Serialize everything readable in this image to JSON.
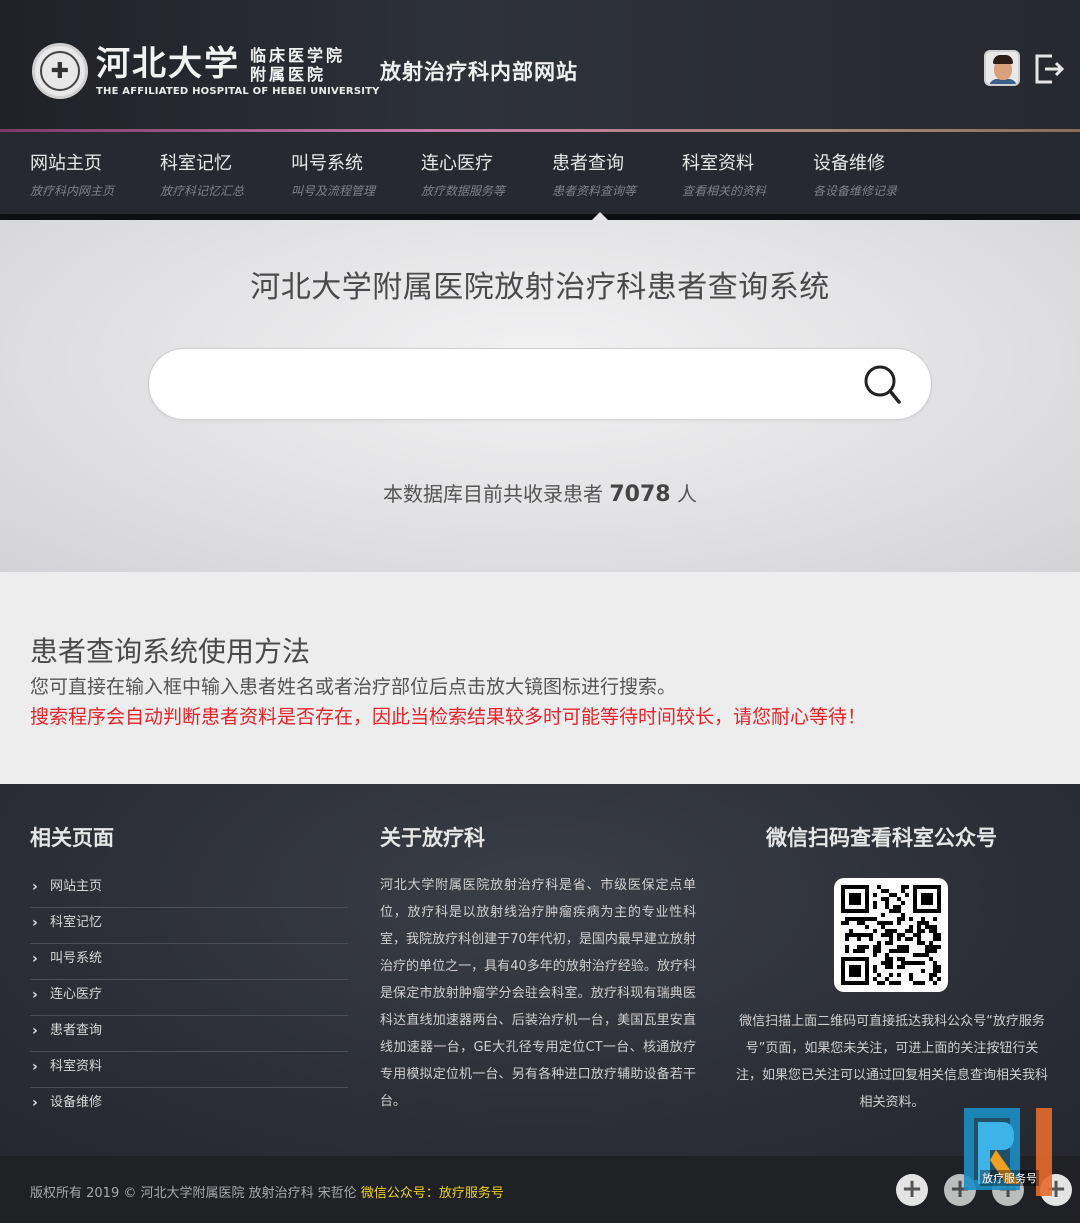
{
  "header": {
    "logo_big": "河北大学",
    "logo_small_1": "临床医学院",
    "logo_small_2": "附属医院",
    "logo_en": "THE AFFILIATED HOSPITAL OF HEBEI UNIVERSITY",
    "site_title": "放射治疗科内部网站"
  },
  "nav": {
    "items": [
      {
        "label": "网站主页",
        "sub": "放疗科内网主页"
      },
      {
        "label": "科室记忆",
        "sub": "放疗科记忆汇总"
      },
      {
        "label": "叫号系统",
        "sub": "叫号及流程管理"
      },
      {
        "label": "连心医疗",
        "sub": "放疗数据服务等"
      },
      {
        "label": "患者查询",
        "sub": "患者资料查询等"
      },
      {
        "label": "科室资料",
        "sub": "查看相关的资料"
      },
      {
        "label": "设备维修",
        "sub": "各设备维修记录"
      }
    ],
    "active_index": 4
  },
  "hero": {
    "title": "河北大学附属医院放射治疗科患者查询系统",
    "search_value": "",
    "count_prefix": "本数据库目前共收录患者",
    "count_value": "7078",
    "count_suffix": "人"
  },
  "usage": {
    "title": "患者查询系统使用方法",
    "line1": "您可直接在输入框中输入患者姓名或者治疗部位后点击放大镜图标进行搜索。",
    "line2": "搜索程序会自动判断患者资料是否存在，因此当检索结果较多时可能等待时间较长，请您耐心等待！",
    "warning_color": "#e8242a"
  },
  "footer": {
    "links_title": "相关页面",
    "links": [
      "网站主页",
      "科室记忆",
      "叫号系统",
      "连心医疗",
      "患者查询",
      "科室资料",
      "设备维修"
    ],
    "about_title": "关于放疗科",
    "about_text": "河北大学附属医院放射治疗科是省、市级医保定点单位，放疗科是以放射线治疗肿瘤疾病为主的专业性科室，我院放疗科创建于70年代初，是国内最早建立放射治疗的单位之一，具有40多年的放射治疗经验。放疗科是保定市放射肿瘤学分会驻会科室。放疗科现有瑞典医科达直线加速器两台、后装治疗机一台，美国瓦里安直线加速器一台，GE大孔径专用定位CT一台、核通放疗专用模拟定位机一台、另有各种进口放疗辅助设备若干台。",
    "wechat_title": "微信扫码查看科室公众号",
    "wechat_text": "微信扫描上面二维码可直接抵达我科公众号“放疗服务号”页面，如果您未关注，可进上面的关注按钮行关注，如果您已关注可以通过回复相关信息查询相关我科相关资料。"
  },
  "bottom": {
    "copyright": "版权所有 2019 © 河北大学附属医院 放射治疗科 宋哲伦",
    "wechat_label": "微信公众号：放疗服务号",
    "watermark_label": "放疗服务号"
  },
  "colors": {
    "accent_line": "#c27aa8",
    "link_yellow": "#f0d21a",
    "nav_bg": "#262930"
  }
}
